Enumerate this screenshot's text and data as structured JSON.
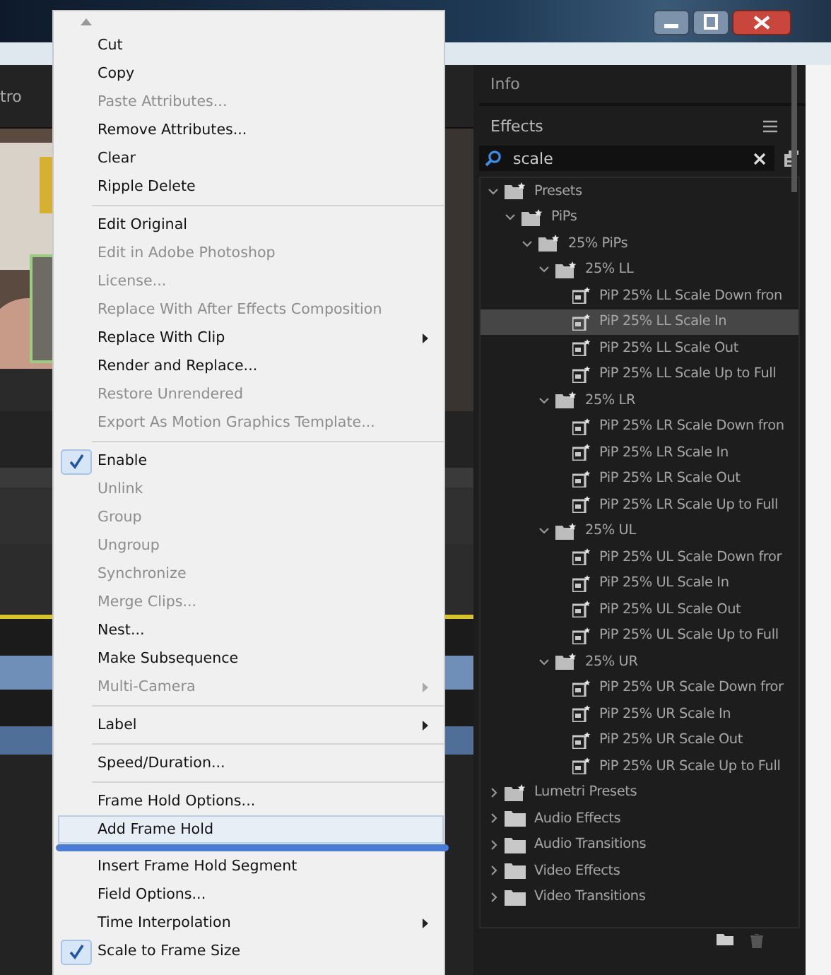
{
  "source_panel": {
    "tab_label": "tro"
  },
  "context_menu": {
    "groups": [
      {
        "items": [
          {
            "label": "Cut",
            "disabled": false,
            "checked": false,
            "submenu": false,
            "selected": false
          },
          {
            "label": "Copy",
            "disabled": false,
            "checked": false,
            "submenu": false,
            "selected": false
          },
          {
            "label": "Paste Attributes...",
            "disabled": true,
            "checked": false,
            "submenu": false,
            "selected": false
          },
          {
            "label": "Remove Attributes...",
            "disabled": false,
            "checked": false,
            "submenu": false,
            "selected": false
          },
          {
            "label": "Clear",
            "disabled": false,
            "checked": false,
            "submenu": false,
            "selected": false
          },
          {
            "label": "Ripple Delete",
            "disabled": false,
            "checked": false,
            "submenu": false,
            "selected": false
          }
        ]
      },
      {
        "items": [
          {
            "label": "Edit Original",
            "disabled": false,
            "checked": false,
            "submenu": false,
            "selected": false
          },
          {
            "label": "Edit in Adobe Photoshop",
            "disabled": true,
            "checked": false,
            "submenu": false,
            "selected": false
          },
          {
            "label": "License...",
            "disabled": true,
            "checked": false,
            "submenu": false,
            "selected": false
          },
          {
            "label": "Replace With After Effects Composition",
            "disabled": true,
            "checked": false,
            "submenu": false,
            "selected": false
          },
          {
            "label": "Replace With Clip",
            "disabled": false,
            "checked": false,
            "submenu": true,
            "selected": false
          },
          {
            "label": "Render and Replace...",
            "disabled": false,
            "checked": false,
            "submenu": false,
            "selected": false
          },
          {
            "label": "Restore Unrendered",
            "disabled": true,
            "checked": false,
            "submenu": false,
            "selected": false
          },
          {
            "label": "Export As Motion Graphics Template...",
            "disabled": true,
            "checked": false,
            "submenu": false,
            "selected": false
          }
        ]
      },
      {
        "items": [
          {
            "label": "Enable",
            "disabled": false,
            "checked": true,
            "submenu": false,
            "selected": false
          },
          {
            "label": "Unlink",
            "disabled": true,
            "checked": false,
            "submenu": false,
            "selected": false
          },
          {
            "label": "Group",
            "disabled": true,
            "checked": false,
            "submenu": false,
            "selected": false
          },
          {
            "label": "Ungroup",
            "disabled": true,
            "checked": false,
            "submenu": false,
            "selected": false
          },
          {
            "label": "Synchronize",
            "disabled": true,
            "checked": false,
            "submenu": false,
            "selected": false
          },
          {
            "label": "Merge Clips...",
            "disabled": true,
            "checked": false,
            "submenu": false,
            "selected": false
          },
          {
            "label": "Nest...",
            "disabled": false,
            "checked": false,
            "submenu": false,
            "selected": false
          },
          {
            "label": "Make Subsequence",
            "disabled": false,
            "checked": false,
            "submenu": false,
            "selected": false
          },
          {
            "label": "Multi-Camera",
            "disabled": true,
            "checked": false,
            "submenu": true,
            "selected": false
          }
        ]
      },
      {
        "items": [
          {
            "label": "Label",
            "disabled": false,
            "checked": false,
            "submenu": true,
            "selected": false
          }
        ]
      },
      {
        "items": [
          {
            "label": "Speed/Duration...",
            "disabled": false,
            "checked": false,
            "submenu": false,
            "selected": false
          }
        ]
      },
      {
        "items": [
          {
            "label": "Frame Hold Options...",
            "disabled": false,
            "checked": false,
            "submenu": false,
            "selected": false
          },
          {
            "label": "Add Frame Hold",
            "disabled": false,
            "checked": false,
            "submenu": false,
            "selected": true
          },
          {
            "label": "Insert Frame Hold Segment",
            "disabled": false,
            "checked": false,
            "submenu": false,
            "selected": false
          },
          {
            "label": "Field Options...",
            "disabled": false,
            "checked": false,
            "submenu": false,
            "selected": false
          },
          {
            "label": "Time Interpolation",
            "disabled": false,
            "checked": false,
            "submenu": true,
            "selected": false
          },
          {
            "label": "Scale to Frame Size",
            "disabled": false,
            "checked": true,
            "submenu": false,
            "selected": false
          }
        ]
      }
    ]
  },
  "effects_panel": {
    "info_tab": "Info",
    "title": "Effects",
    "search": {
      "value": "scale"
    },
    "tree": [
      {
        "kind": "preset_bin",
        "label": "Presets",
        "expanded": true,
        "selected": false,
        "children": [
          {
            "kind": "preset_bin",
            "label": "PiPs",
            "expanded": true,
            "selected": false,
            "children": [
              {
                "kind": "preset_bin",
                "label": "25% PiPs",
                "expanded": true,
                "selected": false,
                "children": [
                  {
                    "kind": "preset_bin",
                    "label": "25% LL",
                    "expanded": true,
                    "selected": false,
                    "children": [
                      {
                        "kind": "preset",
                        "label": "PiP 25% LL Scale Down fron",
                        "selected": false
                      },
                      {
                        "kind": "preset",
                        "label": "PiP 25% LL Scale In",
                        "selected": true
                      },
                      {
                        "kind": "preset",
                        "label": "PiP 25% LL Scale Out",
                        "selected": false
                      },
                      {
                        "kind": "preset",
                        "label": "PiP 25% LL Scale Up to Full",
                        "selected": false
                      }
                    ]
                  },
                  {
                    "kind": "preset_bin",
                    "label": "25% LR",
                    "expanded": true,
                    "selected": false,
                    "children": [
                      {
                        "kind": "preset",
                        "label": "PiP 25% LR Scale Down fron",
                        "selected": false
                      },
                      {
                        "kind": "preset",
                        "label": "PiP 25% LR Scale In",
                        "selected": false
                      },
                      {
                        "kind": "preset",
                        "label": "PiP 25% LR Scale Out",
                        "selected": false
                      },
                      {
                        "kind": "preset",
                        "label": "PiP 25% LR Scale Up to Full",
                        "selected": false
                      }
                    ]
                  },
                  {
                    "kind": "preset_bin",
                    "label": "25% UL",
                    "expanded": true,
                    "selected": false,
                    "children": [
                      {
                        "kind": "preset",
                        "label": "PiP 25% UL Scale Down fror",
                        "selected": false
                      },
                      {
                        "kind": "preset",
                        "label": "PiP 25% UL Scale In",
                        "selected": false
                      },
                      {
                        "kind": "preset",
                        "label": "PiP 25% UL Scale Out",
                        "selected": false
                      },
                      {
                        "kind": "preset",
                        "label": "PiP 25% UL Scale Up to Full",
                        "selected": false
                      }
                    ]
                  },
                  {
                    "kind": "preset_bin",
                    "label": "25% UR",
                    "expanded": true,
                    "selected": false,
                    "children": [
                      {
                        "kind": "preset",
                        "label": "PiP 25% UR Scale Down fror",
                        "selected": false
                      },
                      {
                        "kind": "preset",
                        "label": "PiP 25% UR Scale In",
                        "selected": false
                      },
                      {
                        "kind": "preset",
                        "label": "PiP 25% UR Scale Out",
                        "selected": false
                      },
                      {
                        "kind": "preset",
                        "label": "PiP 25% UR Scale Up to Full",
                        "selected": false
                      }
                    ]
                  }
                ]
              }
            ]
          }
        ]
      },
      {
        "kind": "preset_bin",
        "label": "Lumetri Presets",
        "expanded": false,
        "selected": false
      },
      {
        "kind": "bin",
        "label": "Audio Effects",
        "expanded": false,
        "selected": false
      },
      {
        "kind": "bin",
        "label": "Audio Transitions",
        "expanded": false,
        "selected": false
      },
      {
        "kind": "bin",
        "label": "Video Effects",
        "expanded": false,
        "selected": false
      },
      {
        "kind": "bin",
        "label": "Video Transitions",
        "expanded": false,
        "selected": false
      }
    ]
  }
}
